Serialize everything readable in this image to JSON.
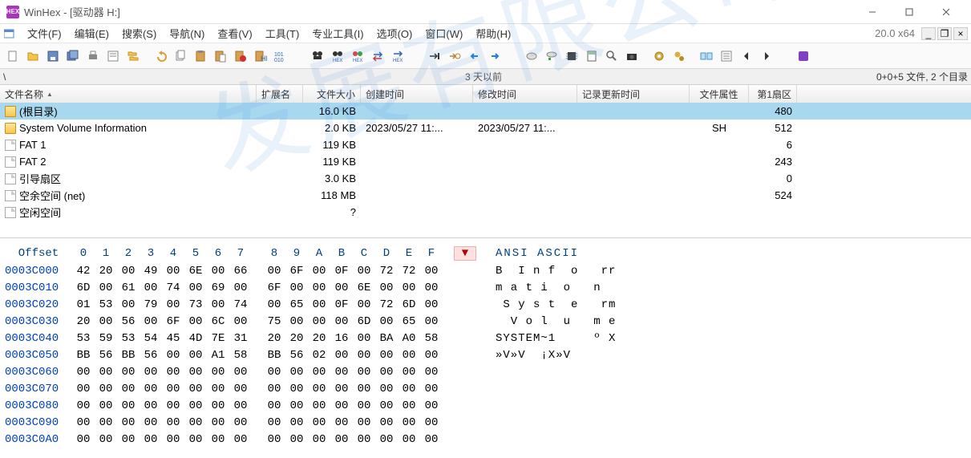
{
  "title": "WinHex - [驱动器 H:]",
  "version": "20.0 x64",
  "menus": [
    "文件(F)",
    "编辑(E)",
    "搜索(S)",
    "导航(N)",
    "查看(V)",
    "工具(T)",
    "专业工具(I)",
    "选项(O)",
    "窗口(W)",
    "帮助(H)"
  ],
  "path_left": "\\",
  "path_center": "3 天以前",
  "path_right": "0+0+5 文件, 2 个目录",
  "columns": {
    "name": "文件名称",
    "ext": "扩展名",
    "size": "文件大小",
    "ctime": "创建时间",
    "mtime": "修改时间",
    "rtime": "记录更新时间",
    "attr": "文件属性",
    "sector": "第1扇区"
  },
  "rows": [
    {
      "icon": "folder",
      "name": "(根目录)",
      "ext": "",
      "size": "16.0 KB",
      "ctime": "",
      "mtime": "",
      "rtime": "",
      "attr": "",
      "sector": "480",
      "sel": true
    },
    {
      "icon": "folder",
      "name": "System Volume Information",
      "ext": "",
      "size": "2.0 KB",
      "ctime": "2023/05/27  11:...",
      "mtime": "2023/05/27  11:...",
      "rtime": "",
      "attr": "SH",
      "sector": "512",
      "sel": false
    },
    {
      "icon": "file",
      "name": "FAT 1",
      "ext": "",
      "size": "119 KB",
      "ctime": "",
      "mtime": "",
      "rtime": "",
      "attr": "",
      "sector": "6",
      "sel": false
    },
    {
      "icon": "file",
      "name": "FAT 2",
      "ext": "",
      "size": "119 KB",
      "ctime": "",
      "mtime": "",
      "rtime": "",
      "attr": "",
      "sector": "243",
      "sel": false
    },
    {
      "icon": "file",
      "name": "引导扇区",
      "ext": "",
      "size": "3.0 KB",
      "ctime": "",
      "mtime": "",
      "rtime": "",
      "attr": "",
      "sector": "0",
      "sel": false
    },
    {
      "icon": "file",
      "name": "空余空间  (net)",
      "ext": "",
      "size": "118 MB",
      "ctime": "",
      "mtime": "",
      "rtime": "",
      "attr": "",
      "sector": "524",
      "sel": false
    },
    {
      "icon": "file",
      "name": "空闲空间",
      "ext": "",
      "size": "?",
      "ctime": "",
      "mtime": "",
      "rtime": "",
      "attr": "",
      "sector": "",
      "sel": false
    }
  ],
  "hex": {
    "header_label": "Offset",
    "cols": [
      "0",
      "1",
      "2",
      "3",
      "4",
      "5",
      "6",
      "7",
      "8",
      "9",
      "A",
      "B",
      "C",
      "D",
      "E",
      "F"
    ],
    "ascii_label": "ANSI ASCII",
    "marker": "▼",
    "lines": [
      {
        "off": "0003C000",
        "b": [
          "42",
          "20",
          "00",
          "49",
          "00",
          "6E",
          "00",
          "66",
          "00",
          "6F",
          "00",
          "0F",
          "00",
          "72",
          "72",
          "00"
        ],
        "a": "B  I n f  o   rr"
      },
      {
        "off": "0003C010",
        "b": [
          "6D",
          "00",
          "61",
          "00",
          "74",
          "00",
          "69",
          "00",
          "6F",
          "00",
          "00",
          "00",
          "6E",
          "00",
          "00",
          "00"
        ],
        "a": "m a t i  o   n"
      },
      {
        "off": "0003C020",
        "b": [
          "01",
          "53",
          "00",
          "79",
          "00",
          "73",
          "00",
          "74",
          "00",
          "65",
          "00",
          "0F",
          "00",
          "72",
          "6D",
          "00"
        ],
        "a": " S y s t  e   rm"
      },
      {
        "off": "0003C030",
        "b": [
          "20",
          "00",
          "56",
          "00",
          "6F",
          "00",
          "6C",
          "00",
          "75",
          "00",
          "00",
          "00",
          "6D",
          "00",
          "65",
          "00"
        ],
        "a": "  V o l  u   m e"
      },
      {
        "off": "0003C040",
        "b": [
          "53",
          "59",
          "53",
          "54",
          "45",
          "4D",
          "7E",
          "31",
          "20",
          "20",
          "20",
          "16",
          "00",
          "BA",
          "A0",
          "58"
        ],
        "a": "SYSTEM~1     º X"
      },
      {
        "off": "0003C050",
        "b": [
          "BB",
          "56",
          "BB",
          "56",
          "00",
          "00",
          "A1",
          "58",
          "BB",
          "56",
          "02",
          "00",
          "00",
          "00",
          "00",
          "00"
        ],
        "a": "»V»V  ¡X»V"
      },
      {
        "off": "0003C060",
        "b": [
          "00",
          "00",
          "00",
          "00",
          "00",
          "00",
          "00",
          "00",
          "00",
          "00",
          "00",
          "00",
          "00",
          "00",
          "00",
          "00"
        ],
        "a": ""
      },
      {
        "off": "0003C070",
        "b": [
          "00",
          "00",
          "00",
          "00",
          "00",
          "00",
          "00",
          "00",
          "00",
          "00",
          "00",
          "00",
          "00",
          "00",
          "00",
          "00"
        ],
        "a": ""
      },
      {
        "off": "0003C080",
        "b": [
          "00",
          "00",
          "00",
          "00",
          "00",
          "00",
          "00",
          "00",
          "00",
          "00",
          "00",
          "00",
          "00",
          "00",
          "00",
          "00"
        ],
        "a": ""
      },
      {
        "off": "0003C090",
        "b": [
          "00",
          "00",
          "00",
          "00",
          "00",
          "00",
          "00",
          "00",
          "00",
          "00",
          "00",
          "00",
          "00",
          "00",
          "00",
          "00"
        ],
        "a": ""
      },
      {
        "off": "0003C0A0",
        "b": [
          "00",
          "00",
          "00",
          "00",
          "00",
          "00",
          "00",
          "00",
          "00",
          "00",
          "00",
          "00",
          "00",
          "00",
          "00",
          "00"
        ],
        "a": ""
      }
    ]
  }
}
